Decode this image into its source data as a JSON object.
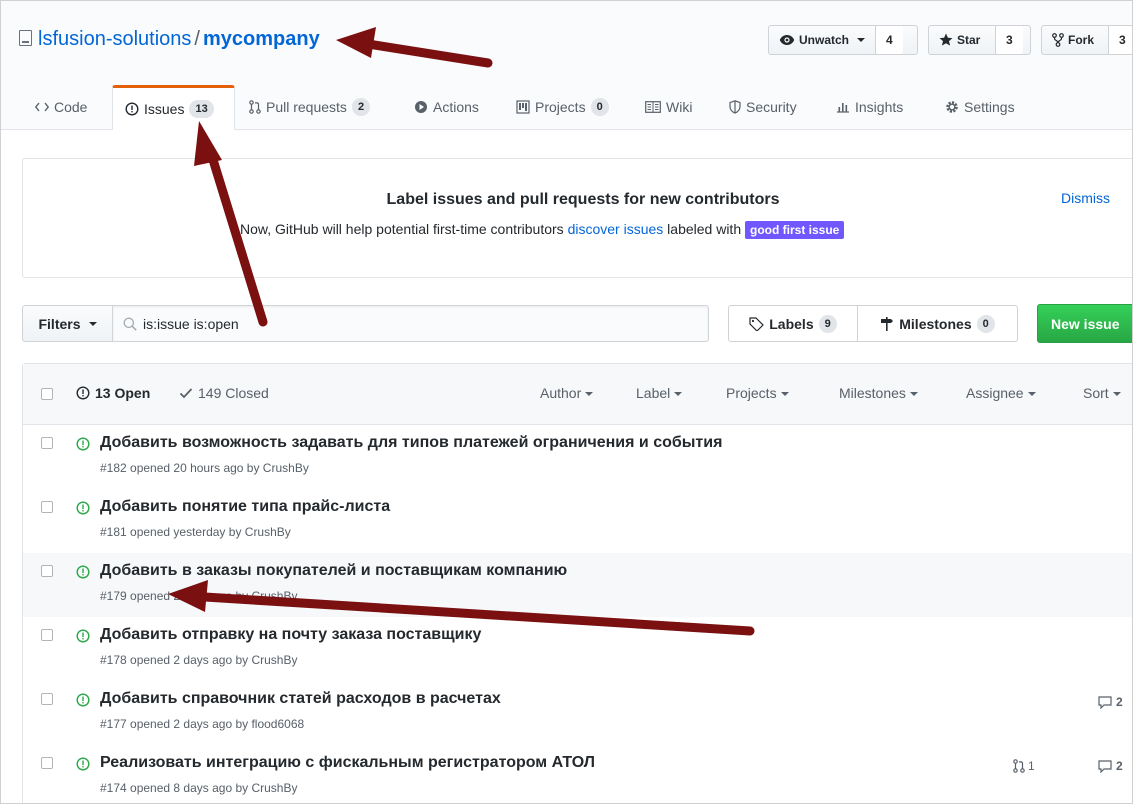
{
  "repo": {
    "owner": "lsfusion-solutions",
    "separator": "/",
    "name": "mycompany"
  },
  "header_buttons": {
    "watch": {
      "label": "Unwatch",
      "count": "4"
    },
    "star": {
      "label": "Star",
      "count": "3"
    },
    "fork": {
      "label": "Fork",
      "count": "3"
    }
  },
  "tabs": [
    {
      "label": "Code"
    },
    {
      "label": "Issues",
      "count": "13"
    },
    {
      "label": "Pull requests",
      "count": "2"
    },
    {
      "label": "Actions"
    },
    {
      "label": "Projects",
      "count": "0"
    },
    {
      "label": "Wiki"
    },
    {
      "label": "Security"
    },
    {
      "label": "Insights"
    },
    {
      "label": "Settings"
    }
  ],
  "banner": {
    "title": "Label issues and pull requests for new contributors",
    "text_before": "Now, GitHub will help potential first-time contributors ",
    "link": "discover issues",
    "text_after": " labeled with ",
    "label": "good first issue",
    "dismiss": "Dismiss"
  },
  "filter_bar": {
    "filters_label": "Filters",
    "search_value": "is:issue is:open",
    "labels_label": "Labels",
    "labels_count": "9",
    "milestones_label": "Milestones",
    "milestones_count": "0",
    "new_issue_label": "New issue"
  },
  "list_header": {
    "open": "13 Open",
    "closed": "149 Closed",
    "dropdowns": [
      "Author",
      "Label",
      "Projects",
      "Milestones",
      "Assignee",
      "Sort"
    ]
  },
  "issues": [
    {
      "title": "Добавить возможность задавать для типов платежей ограничения и события",
      "meta": "#182 opened 20 hours ago by CrushBy",
      "prs": "",
      "comments": ""
    },
    {
      "title": "Добавить понятие типа прайс-листа",
      "meta": "#181 opened yesterday by CrushBy",
      "prs": "",
      "comments": ""
    },
    {
      "title": "Добавить в заказы покупателей и поставщикам компанию",
      "meta": "#179 opened 2 days ago by CrushBy",
      "prs": "",
      "comments": ""
    },
    {
      "title": "Добавить отправку на почту заказа поставщику",
      "meta": "#178 opened 2 days ago by CrushBy",
      "prs": "",
      "comments": ""
    },
    {
      "title": "Добавить справочник статей расходов в расчетах",
      "meta": "#177 opened 2 days ago by flood6068",
      "prs": "",
      "comments": "2"
    },
    {
      "title": "Реализовать интеграцию с фискальным регистратором АТОЛ",
      "meta": "#174 opened 8 days ago by CrushBy",
      "prs": "1",
      "comments": "2"
    }
  ],
  "colors": {
    "link": "#0366d6",
    "open_green": "#28a745",
    "accent_tab": "#e36209",
    "good_first_issue": "#7057ff",
    "annotation_arrow": "#7b1010"
  }
}
